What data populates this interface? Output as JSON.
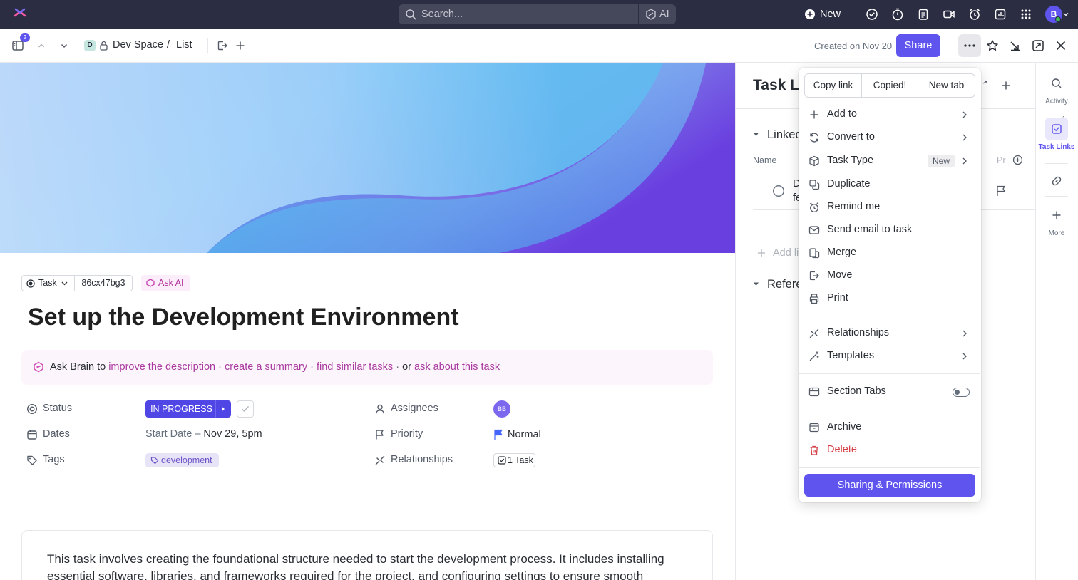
{
  "topbar": {
    "search_placeholder": "Search...",
    "ai_label": "AI",
    "new_label": "New",
    "avatar_initial": "B"
  },
  "subbar": {
    "notification_count": "2",
    "workspace_initial": "D",
    "breadcrumb_space": "Dev Space",
    "breadcrumb_sep": "/",
    "breadcrumb_list": "List",
    "created_text": "Created on Nov 20",
    "share_label": "Share"
  },
  "task": {
    "type_label": "Task",
    "id": "86cx47bg3",
    "ask_ai_label": "Ask AI",
    "title": "Set up the Development Environment"
  },
  "brain": {
    "prefix": "Ask Brain to",
    "link1": "improve the description",
    "link2": "create a summary",
    "link3": "find similar tasks",
    "or": "or",
    "link4": "ask about this task",
    "dot": "·"
  },
  "fields": {
    "status_label": "Status",
    "status_value": "IN PROGRESS",
    "dates_label": "Dates",
    "start_label": "Start Date",
    "dash": "–",
    "start_value": "Nov 29, 5pm",
    "tags_label": "Tags",
    "tag_value": "development",
    "assignees_label": "Assignees",
    "assignee_initials": "BB",
    "priority_label": "Priority",
    "priority_value": "Normal",
    "relationships_label": "Relationships",
    "relationships_value": "1 Task"
  },
  "description": "This task involves creating the foundational structure needed to start the development process. It includes installing essential software, libraries, and frameworks required for the project, and configuring settings to ensure smooth",
  "right_panel": {
    "title": "Task Li",
    "linked_label": "Linked",
    "name_col": "Name",
    "pri_col": "Pr",
    "row_text_1": "D",
    "row_text_2": "fe",
    "add_link": "Add li",
    "references_label": "Refere"
  },
  "rail": {
    "activity_label": "Activity",
    "task_links_label": "Task Links",
    "task_links_count": "1",
    "more_label": "More"
  },
  "menu": {
    "copy_link": "Copy link",
    "copied": "Copied!",
    "new_tab": "New tab",
    "items": [
      {
        "label": "Add to"
      },
      {
        "label": "Convert to"
      },
      {
        "label": "Task Type",
        "badge": "New"
      },
      {
        "label": "Duplicate"
      },
      {
        "label": "Remind me"
      },
      {
        "label": "Send email to task"
      },
      {
        "label": "Merge"
      },
      {
        "label": "Move"
      },
      {
        "label": "Print"
      },
      {
        "label": "Relationships"
      },
      {
        "label": "Templates"
      },
      {
        "label": "Section Tabs"
      },
      {
        "label": "Archive"
      },
      {
        "label": "Delete"
      }
    ],
    "permissions_button": "Sharing & Permissions"
  },
  "colors": {
    "accent": "#5f55ee",
    "status": "#4f46e5",
    "danger": "#d33d44",
    "topbar": "#2b2d42"
  }
}
